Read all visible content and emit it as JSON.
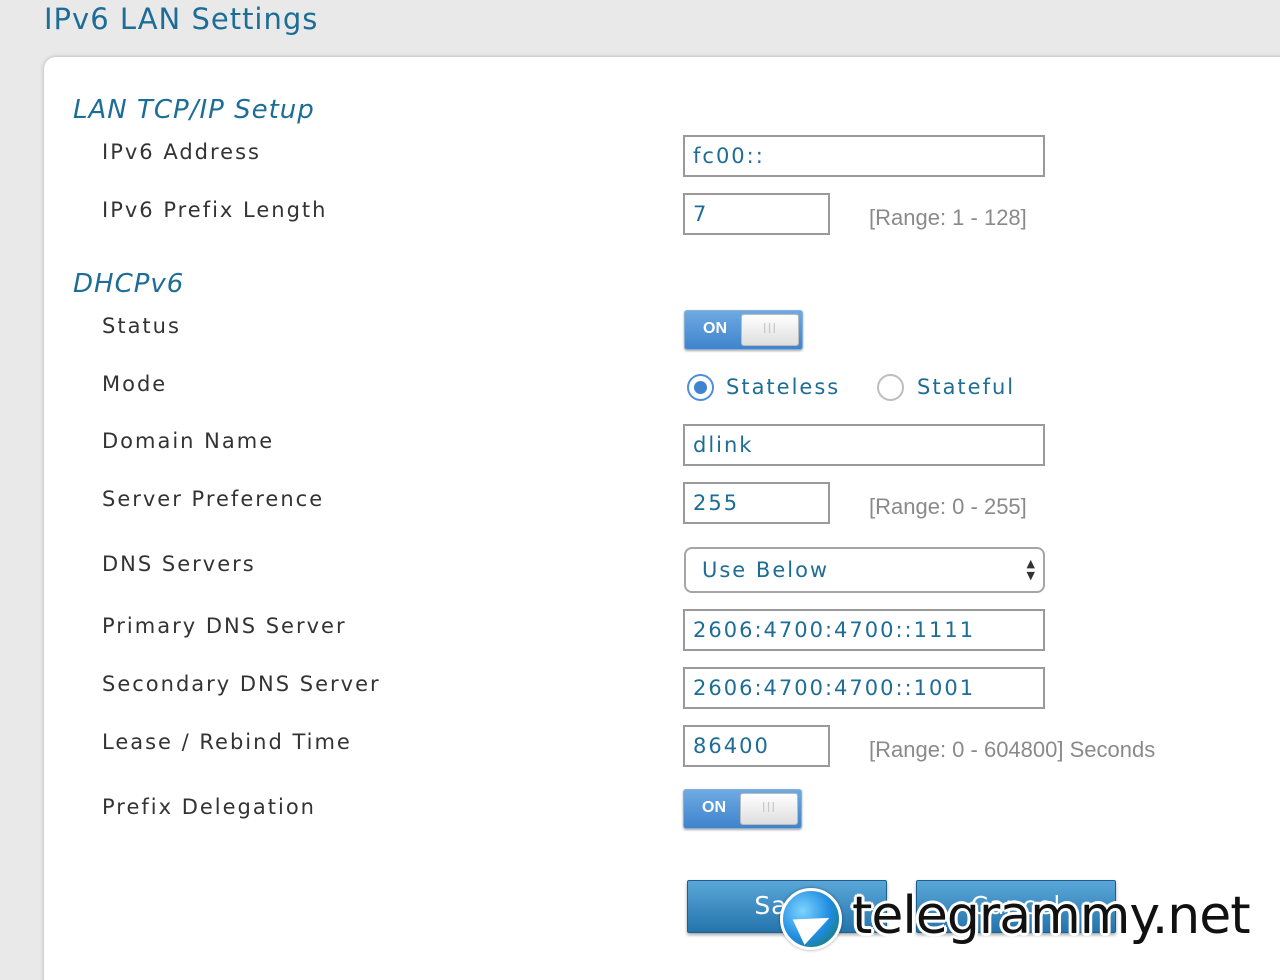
{
  "page": {
    "title": "IPv6 LAN Settings"
  },
  "lan": {
    "section_title": "LAN TCP/IP Setup",
    "ipv6_address": {
      "label": "IPv6 Address",
      "value": "fc00::"
    },
    "prefix_length": {
      "label": "IPv6 Prefix Length",
      "value": "7",
      "range": "[Range: 1 - 128]"
    }
  },
  "dhcp": {
    "section_title": "DHCPv6",
    "status": {
      "label": "Status",
      "toggle_text": "ON",
      "knob_text": "III"
    },
    "mode": {
      "label": "Mode",
      "options": [
        "Stateless",
        "Stateful"
      ],
      "selected": "Stateless"
    },
    "domain_name": {
      "label": "Domain Name",
      "value": "dlink"
    },
    "server_preference": {
      "label": "Server Preference",
      "value": "255",
      "range": "[Range: 0 - 255]"
    },
    "dns_servers": {
      "label": "DNS Servers",
      "value": "Use Below"
    },
    "primary_dns": {
      "label": "Primary DNS Server",
      "value": "2606:4700:4700::1111"
    },
    "secondary_dns": {
      "label": "Secondary DNS Server",
      "value": "2606:4700:4700::1001"
    },
    "lease_time": {
      "label": "Lease / Rebind Time",
      "value": "86400",
      "range": "[Range: 0 - 604800] Seconds"
    },
    "prefix_delegation": {
      "label": "Prefix Delegation",
      "toggle_text": "ON",
      "knob_text": "III"
    }
  },
  "buttons": {
    "save": "Save",
    "cancel": "Cancel"
  },
  "watermark": {
    "text": "telegrammy.net"
  },
  "colors": {
    "accent": "#1d6d96",
    "toggle": "#3f84cc",
    "button": "#2475ad"
  }
}
